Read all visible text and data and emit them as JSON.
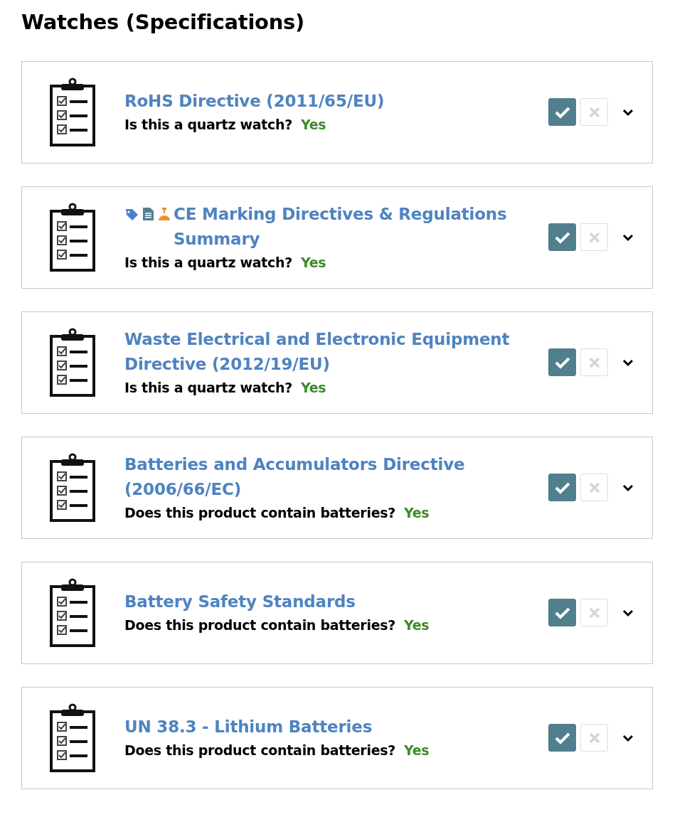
{
  "heading": "Watches (Specifications)",
  "requirements": [
    {
      "title": "RoHS Directive (2011/65/EU)",
      "question": "Is this a quartz watch?",
      "answer": "Yes",
      "approved": true,
      "expanded": false
    },
    {
      "badges": [
        {
          "kind": "tag"
        },
        {
          "kind": "document"
        },
        {
          "kind": "flask"
        }
      ],
      "title": "CE Marking Directives & Regulations Summary",
      "question": "Is this a quartz watch?",
      "answer": "Yes",
      "approved": true,
      "expanded": false
    },
    {
      "title": "Waste Electrical and Electronic Equipment Directive (2012/19/EU)",
      "question": "Is this a quartz watch?",
      "answer": "Yes",
      "approved": true,
      "expanded": false
    },
    {
      "title": "Batteries and Accumulators Directive (2006/66/EC)",
      "question": "Does this product contain batteries?",
      "answer": "Yes",
      "approved": true,
      "expanded": false
    },
    {
      "title": "Battery Safety Standards",
      "question": "Does this product contain batteries?",
      "answer": "Yes",
      "approved": true,
      "expanded": false
    },
    {
      "title": "UN 38.3 - Lithium Batteries",
      "question": "Does this product contain batteries?",
      "answer": "Yes",
      "approved": true,
      "expanded": false
    }
  ]
}
